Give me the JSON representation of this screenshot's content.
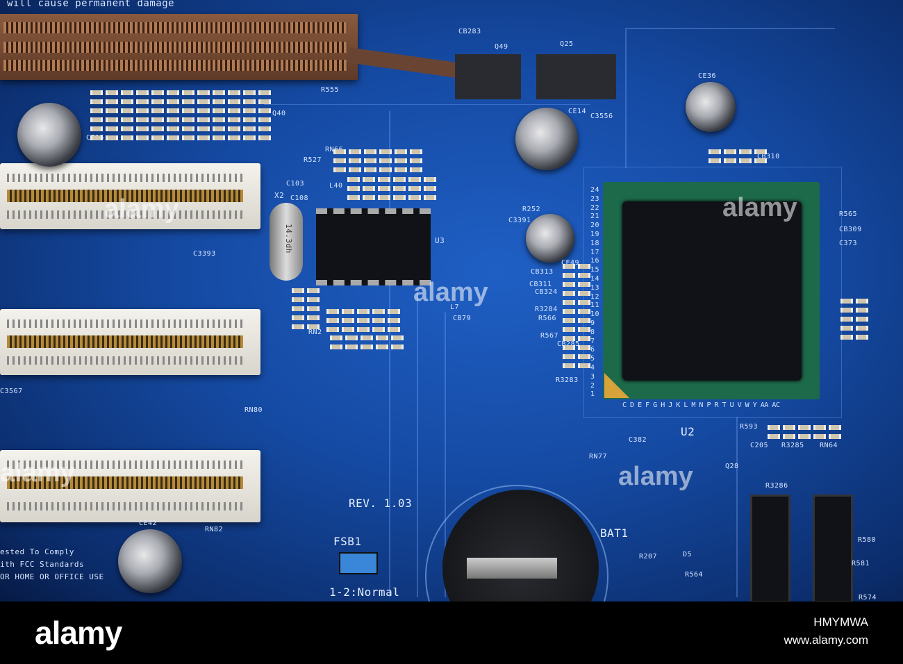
{
  "board": {
    "warning": "will cause permanent damage",
    "revision": "REV. 1.03",
    "jumper_label": "FSB1",
    "jumper_setting": "1-2:Normal",
    "battery_label": "BAT1",
    "chip_main": "U2",
    "chip_small": "U3",
    "crystal_label": "X2",
    "crystal_marking": "14.3dh",
    "fcc_lines": [
      "ested To Comply",
      "ith FCC Standards",
      "OR HOME OR OFFICE USE"
    ],
    "component_labels": [
      "CB283",
      "Q49",
      "Q25",
      "CE36",
      "CE15",
      "CE14",
      "C3556",
      "Q40",
      "R555",
      "C103",
      "L40",
      "C108",
      "R527",
      "RN66",
      "R252",
      "C3391",
      "CB313",
      "CB311",
      "CB324",
      "R3284",
      "R566",
      "R567",
      "CB285",
      "R3283",
      "CE49",
      "RN2",
      "CB79",
      "L7",
      "RN80",
      "RN82",
      "RN77",
      "C382",
      "R593",
      "C205",
      "R3285",
      "RN64",
      "Q28",
      "R3286",
      "R207",
      "D5",
      "R564",
      "R580",
      "R581",
      "R574",
      "CB310",
      "C3393",
      "C3567",
      "CE42",
      "R565",
      "CB309",
      "C373"
    ],
    "bga_columns": "C D E F G H J K L M N P R T U V W Y AA AC",
    "bga_rows": [
      "24",
      "23",
      "22",
      "21",
      "20",
      "19",
      "18",
      "17",
      "16",
      "15",
      "14",
      "13",
      "12",
      "11",
      "10",
      "9",
      "8",
      "7",
      "6",
      "5",
      "4",
      "3",
      "2",
      "1"
    ]
  },
  "watermark": "alamy",
  "footer": {
    "logo": "alamy",
    "image_code": "HMYMWA",
    "url": "www.alamy.com"
  },
  "colors": {
    "board": "#154aa3",
    "footer": "#000000"
  }
}
